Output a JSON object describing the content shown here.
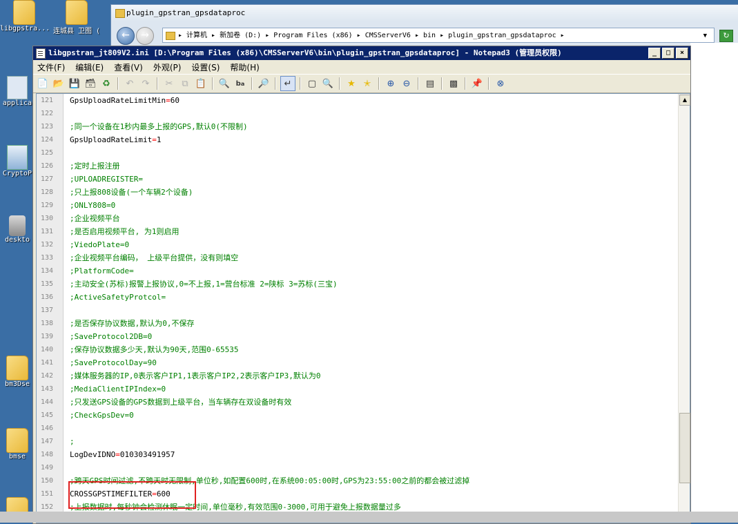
{
  "desktop": {
    "icons": [
      {
        "label": "libgpstra..."
      },
      {
        "label": "连城县 卫图 ("
      },
      {
        "label": "applica"
      },
      {
        "label": "CryptoP"
      },
      {
        "label": "deskto"
      },
      {
        "label": "bm3Dse"
      },
      {
        "label": "bmse"
      }
    ]
  },
  "explorer": {
    "title": "plugin_gpstran_gpsdataproc",
    "address": "▸ 计算机 ▸ 新加卷 (D:) ▸ Program Files (x86) ▸ CMSServerV6 ▸ bin ▸ plugin_gpstran_gpsdataproc ▸"
  },
  "notepad": {
    "title": "libgpstran_jt809V2.ini [D:\\Program Files (x86)\\CMSServerV6\\bin\\plugin_gpstran_gpsdataproc] - Notepad3 (管理员权限)",
    "window_buttons": [
      "_",
      "□",
      "×"
    ],
    "menu": [
      "文件(F)",
      "编辑(E)",
      "查看(V)",
      "外观(P)",
      "设置(S)",
      "帮助(H)"
    ],
    "toolbar_icons": [
      "new-file-icon",
      "open-file-icon",
      "save-icon",
      "save-all-icon",
      "history-icon",
      "undo-icon",
      "redo-icon",
      "cut-icon",
      "copy-icon",
      "paste-icon",
      "find-icon",
      "replace-icon",
      "goto-icon",
      "wordwrap-icon",
      "select-icon",
      "zoom-find-icon",
      "favorite-icon",
      "add-favorite-icon",
      "zoom-in-icon",
      "zoom-out-icon",
      "schema-icon",
      "scheme-config-icon",
      "pin-icon",
      "close-circle-icon"
    ]
  },
  "lines": [
    {
      "no": "121",
      "key": "GpsUploadRateLimitMin",
      "eq": "=",
      "val": "60",
      "cmt": ""
    },
    {
      "no": "122",
      "key": "",
      "eq": "",
      "val": "",
      "cmt": ""
    },
    {
      "no": "123",
      "key": "",
      "eq": "",
      "val": "",
      "cmt": ";同一个设备在1秒内最多上报的GPS,默认0(不限制)"
    },
    {
      "no": "124",
      "key": "GpsUploadRateLimit",
      "eq": "=",
      "val": "1",
      "cmt": ""
    },
    {
      "no": "125",
      "key": "",
      "eq": "",
      "val": "",
      "cmt": ""
    },
    {
      "no": "126",
      "key": "",
      "eq": "",
      "val": "",
      "cmt": ";定时上报注册"
    },
    {
      "no": "127",
      "key": "",
      "eq": "",
      "val": "",
      "cmt": ";UPLOADREGISTER="
    },
    {
      "no": "128",
      "key": "",
      "eq": "",
      "val": "",
      "cmt": ";只上报808设备(一个车辆2个设备)"
    },
    {
      "no": "129",
      "key": "",
      "eq": "",
      "val": "",
      "cmt": ";ONLY808=0"
    },
    {
      "no": "130",
      "key": "",
      "eq": "",
      "val": "",
      "cmt": ";企业视频平台"
    },
    {
      "no": "131",
      "key": "",
      "eq": "",
      "val": "",
      "cmt": ";是否启用视频平台, 为1则启用"
    },
    {
      "no": "132",
      "key": "",
      "eq": "",
      "val": "",
      "cmt": ";ViedoPlate=0"
    },
    {
      "no": "133",
      "key": "",
      "eq": "",
      "val": "",
      "cmt": ";企业视频平台编码，  上级平台提供，没有则填空"
    },
    {
      "no": "134",
      "key": "",
      "eq": "",
      "val": "",
      "cmt": ";PlatformCode="
    },
    {
      "no": "135",
      "key": "",
      "eq": "",
      "val": "",
      "cmt": ";主动安全(苏标)报警上报协议,0=不上报,1=营台标准 2=陕标 3=苏标(三宝)"
    },
    {
      "no": "136",
      "key": "",
      "eq": "",
      "val": "",
      "cmt": ";ActiveSafetyProtcol="
    },
    {
      "no": "137",
      "key": "",
      "eq": "",
      "val": "",
      "cmt": ""
    },
    {
      "no": "138",
      "key": "",
      "eq": "",
      "val": "",
      "cmt": ";是否保存协议数据,默认为0,不保存"
    },
    {
      "no": "139",
      "key": "",
      "eq": "",
      "val": "",
      "cmt": ";SaveProtocol2DB=0"
    },
    {
      "no": "140",
      "key": "",
      "eq": "",
      "val": "",
      "cmt": ";保存协议数据多少天,默认为90天,范围0-65535"
    },
    {
      "no": "141",
      "key": "",
      "eq": "",
      "val": "",
      "cmt": ";SaveProtocolDay=90"
    },
    {
      "no": "142",
      "key": "",
      "eq": "",
      "val": "",
      "cmt": ";媒体服务器的IP,0表示客户IP1,1表示客户IP2,2表示客户IP3,默认为0"
    },
    {
      "no": "143",
      "key": "",
      "eq": "",
      "val": "",
      "cmt": ";MediaClientIPIndex=0"
    },
    {
      "no": "144",
      "key": "",
      "eq": "",
      "val": "",
      "cmt": ";只发送GPS设备的GPS数据到上级平台，当车辆存在双设备时有效"
    },
    {
      "no": "145",
      "key": "",
      "eq": "",
      "val": "",
      "cmt": ";CheckGpsDev=0"
    },
    {
      "no": "146",
      "key": "",
      "eq": "",
      "val": "",
      "cmt": ""
    },
    {
      "no": "147",
      "key": "",
      "eq": "",
      "val": "",
      "cmt": ";"
    },
    {
      "no": "148",
      "key": "LogDevIDNO",
      "eq": "=",
      "val": "010303491957",
      "cmt": ""
    },
    {
      "no": "149",
      "key": "",
      "eq": "",
      "val": "",
      "cmt": ""
    },
    {
      "no": "150",
      "key": "",
      "eq": "",
      "val": "",
      "cmt": ";跨天GPS时间过滤,不跨天时无限制,单位秒,如配置600时,在系统00:05:00时,GPS为23:55:00之前的都会被过滤掉"
    },
    {
      "no": "151",
      "key": "CROSSGPSTIMEFILTER",
      "eq": "=",
      "val": "600",
      "cmt": ""
    },
    {
      "no": "152",
      "key": "",
      "eq": "",
      "val": "",
      "cmt": ";上报数据时,每秒钟会检测休眠一定时间,单位毫秒,有效范围0-3000,可用于避免上报数据量过多"
    }
  ]
}
